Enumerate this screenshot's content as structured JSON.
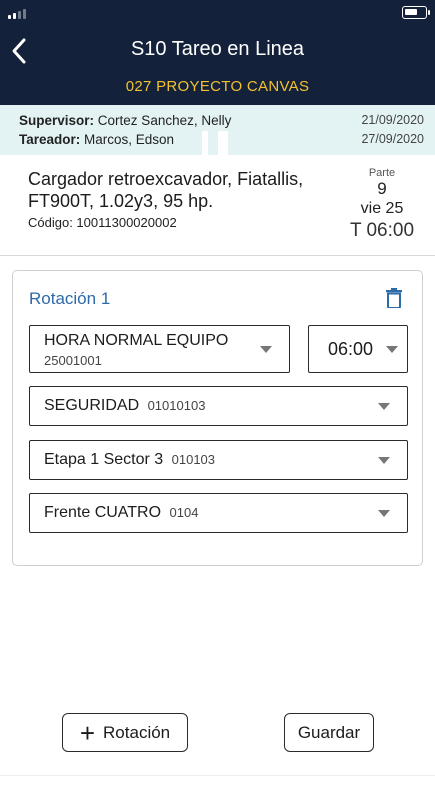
{
  "header": {
    "title": "S10 Tareo en Linea",
    "project": "027 PROYECTO CANVAS",
    "accent_color": "#f2c22e",
    "background_color": "#14213a"
  },
  "info": {
    "supervisor_label": "Supervisor:",
    "supervisor_name": "Cortez Sanchez, Nelly",
    "supervisor_date": "21/09/2020",
    "tareador_label": "Tareador:",
    "tareador_name": "Marcos, Edson",
    "tareador_date": "27/09/2020"
  },
  "equipment": {
    "name": "Cargador retroexcavador, Fiatallis, FT900T, 1.02y3, 95 hp.",
    "code": "Código: 10011300020002"
  },
  "parte": {
    "label": "Parte",
    "number": "9",
    "day": "vie 25",
    "time": "T 06:00"
  },
  "rotation": {
    "title": "Rotación 1",
    "delete_icon": "trash-icon",
    "hour_type": {
      "label": "HORA NORMAL EQUIPO",
      "code": "25001001"
    },
    "hours": "06:00",
    "phase": {
      "label": "SEGURIDAD",
      "code": "01010103"
    },
    "stage": {
      "label": "Etapa 1 Sector 3",
      "code": "010103"
    },
    "front": {
      "label": "Frente CUATRO",
      "code": "0104"
    }
  },
  "actions": {
    "add_rotation": "Rotación",
    "add_icon": "plus-icon",
    "save": "Guardar"
  }
}
